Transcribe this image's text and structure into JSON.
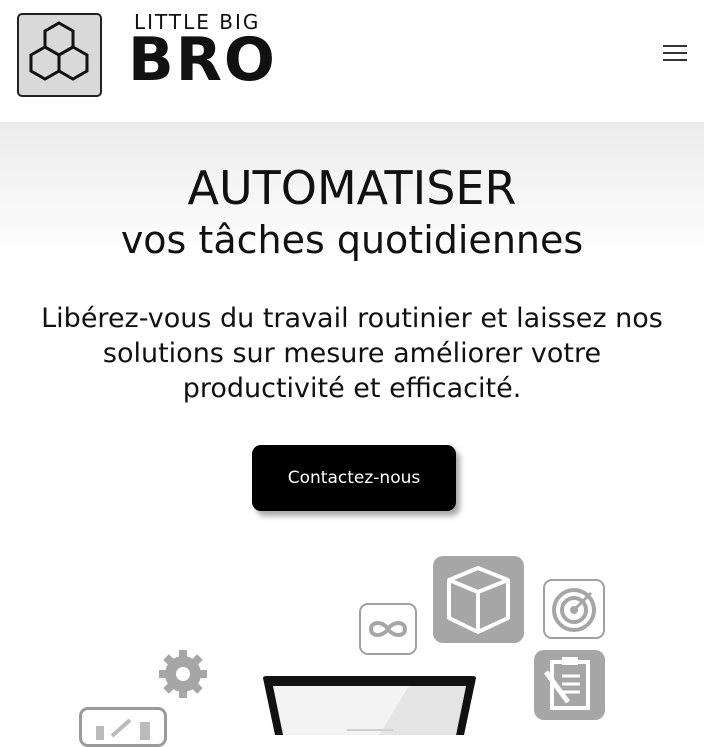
{
  "brand": {
    "line1": "LITTLE BIG",
    "line2": "BRO"
  },
  "nav": {
    "menu_icon": "hamburger-menu-icon"
  },
  "hero": {
    "title": "AUTOMATISER",
    "subtitle": "vos tâches quotidiennes",
    "lead": "Libérez-vous du travail routinier et laissez nos solutions sur mesure améliorer votre productivité et efficacité.",
    "cta_label": "Contactez-nous"
  },
  "illustration": {
    "icons": [
      "gear-icon",
      "infinity-icon",
      "cube-icon",
      "target-icon",
      "clipboard-icon",
      "laptop-icon",
      "chart-icon"
    ]
  },
  "colors": {
    "cta_bg": "#000000",
    "text": "#111111",
    "tile_gray": "#a6a6a6"
  }
}
